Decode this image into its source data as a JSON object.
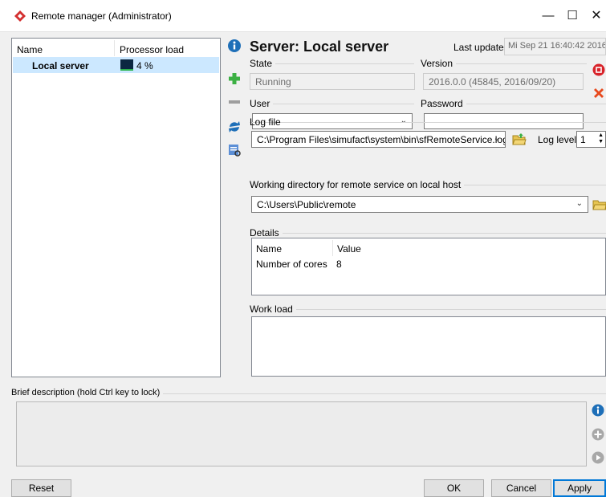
{
  "window": {
    "title": "Remote manager (Administrator)",
    "minimize": "—",
    "maximize": "☐",
    "close": "✕",
    "icon": "simufact-logo-icon"
  },
  "server_list": {
    "columns": [
      "Name",
      "Processor load"
    ],
    "rows": [
      {
        "name": "Local server",
        "load_text": "4 %",
        "load_fraction": 0.04
      }
    ]
  },
  "toolbar": {
    "icons": [
      "info-icon",
      "add-server-icon",
      "remove-server-icon",
      "refresh-icon",
      "log-view-icon"
    ]
  },
  "server": {
    "title": "Server: Local server",
    "last_update_label": "Last update",
    "last_update_value": "Mi Sep 21 16:40:42 2016",
    "state_label": "State",
    "state_value": "Running",
    "version_label": "Version",
    "version_value": "2016.0.0 (45845, 2016/09/20)",
    "user_label": "User",
    "user_value": "",
    "password_label": "Password",
    "password_value": "",
    "log_file_label": "Log file",
    "log_file_value": "C:\\Program Files\\simufact\\system\\bin\\sfRemoteService.log",
    "log_level_label": "Log level",
    "log_level_value": "1",
    "workdir_label": "Working directory for remote service on local host",
    "workdir_value": "C:\\Users\\Public\\remote",
    "details_label": "Details",
    "details_columns": [
      "Name",
      "Value"
    ],
    "details_rows": [
      {
        "name": "Number of cores",
        "value": "8"
      }
    ],
    "workload_label": "Work load"
  },
  "description": {
    "label": "Brief description (hold Ctrl key to lock)",
    "text": ""
  },
  "footer": {
    "reset": "Reset",
    "ok": "OK",
    "cancel": "Cancel",
    "apply": "Apply"
  },
  "colors": {
    "selection": "#cce8ff",
    "accent": "#0078d7",
    "stop_red": "#d8232a"
  }
}
